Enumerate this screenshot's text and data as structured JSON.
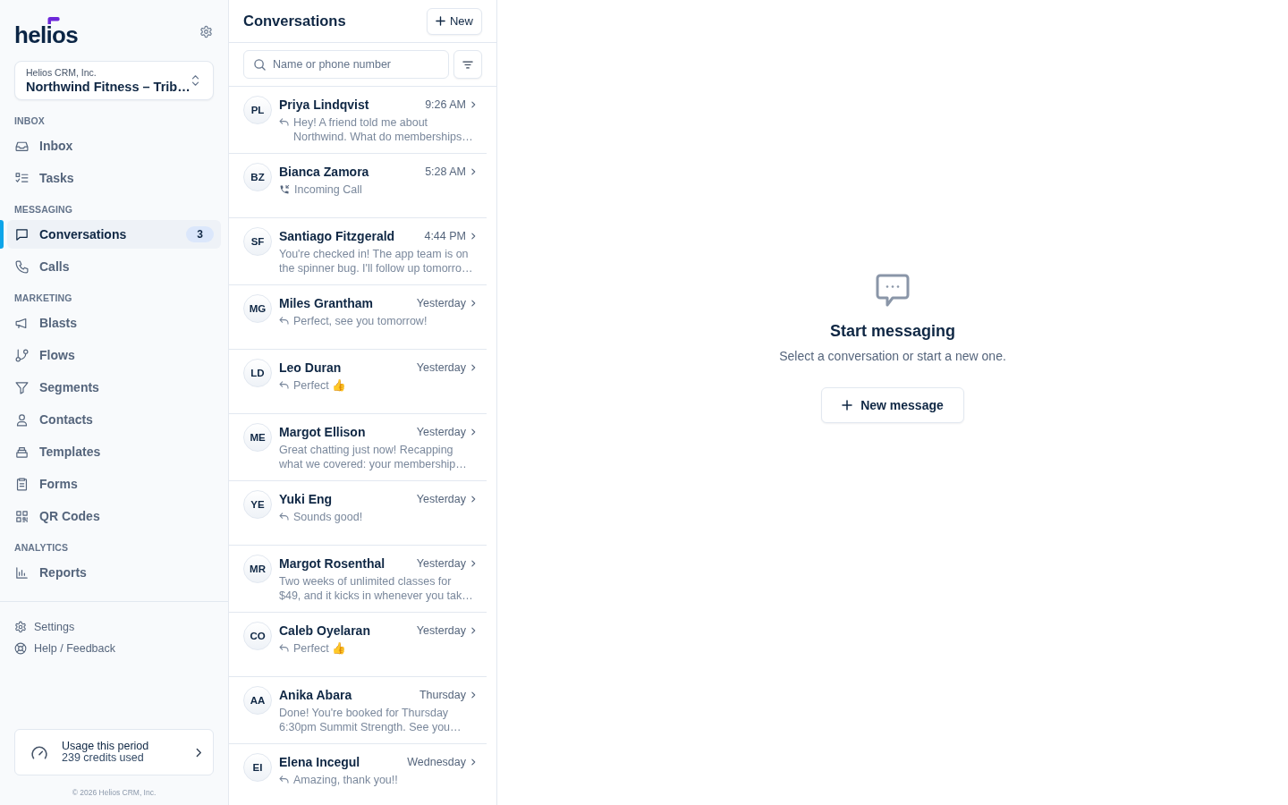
{
  "sidebar": {
    "logo": "helios",
    "workspace": {
      "company": "Helios CRM, Inc.",
      "name": "Northwind Fitness – Trib…"
    },
    "sections": [
      {
        "label": "INBOX",
        "items": [
          {
            "label": "Inbox",
            "selected": false
          },
          {
            "label": "Tasks",
            "selected": false
          }
        ]
      },
      {
        "label": "MESSAGING",
        "items": [
          {
            "label": "Conversations",
            "selected": true,
            "badge": "3"
          },
          {
            "label": "Calls",
            "selected": false
          }
        ]
      },
      {
        "label": "MARKETING",
        "items": [
          {
            "label": "Blasts",
            "selected": false
          },
          {
            "label": "Flows",
            "selected": false
          },
          {
            "label": "Segments",
            "selected": false
          },
          {
            "label": "Contacts",
            "selected": false
          },
          {
            "label": "Templates",
            "selected": false
          },
          {
            "label": "Forms",
            "selected": false
          },
          {
            "label": "QR Codes",
            "selected": false
          }
        ]
      },
      {
        "label": "ANALYTICS",
        "items": [
          {
            "label": "Reports",
            "selected": false
          }
        ]
      }
    ],
    "footer_links": [
      "Settings",
      "Help / Feedback"
    ],
    "usage": {
      "title": "Usage this period",
      "detail": "239 credits used"
    },
    "copyright": "© 2026 Helios CRM, Inc."
  },
  "conversations": {
    "title": "Conversations",
    "new_button": "New",
    "search": {
      "placeholder": "Name or phone number"
    },
    "items": [
      {
        "initials": "PL",
        "name": "Priya Lindqvist",
        "time": "9:26 AM",
        "kind": "reply",
        "preview": "Hey! A friend told me about Northwind. What do memberships…"
      },
      {
        "initials": "BZ",
        "name": "Bianca Zamora",
        "time": "5:28 AM",
        "kind": "call",
        "preview": "Incoming Call"
      },
      {
        "initials": "SF",
        "name": "Santiago Fitzgerald",
        "time": "4:44 PM",
        "kind": "message",
        "preview": "You're checked in! The app team is on the spinner bug. I'll follow up tomorro…"
      },
      {
        "initials": "MG",
        "name": "Miles Grantham",
        "time": "Yesterday",
        "kind": "reply",
        "preview": "Perfect, see you tomorrow!"
      },
      {
        "initials": "LD",
        "name": "Leo Duran",
        "time": "Yesterday",
        "kind": "reply",
        "preview": "Perfect 👍"
      },
      {
        "initials": "ME",
        "name": "Margot Ellison",
        "time": "Yesterday",
        "kind": "message",
        "preview": "Great chatting just now! Recapping what we covered: your membership…"
      },
      {
        "initials": "YE",
        "name": "Yuki Eng",
        "time": "Yesterday",
        "kind": "reply",
        "preview": "Sounds good!"
      },
      {
        "initials": "MR",
        "name": "Margot Rosenthal",
        "time": "Yesterday",
        "kind": "message",
        "preview": "Two weeks of unlimited classes for $49, and it kicks in whenever you tak…"
      },
      {
        "initials": "CO",
        "name": "Caleb Oyelaran",
        "time": "Yesterday",
        "kind": "reply",
        "preview": "Perfect 👍"
      },
      {
        "initials": "AA",
        "name": "Anika Abara",
        "time": "Thursday",
        "kind": "message",
        "preview": "Done! You're booked for Thursday 6:30pm Summit Strength. See you…"
      },
      {
        "initials": "EI",
        "name": "Elena Incegul",
        "time": "Wednesday",
        "kind": "reply",
        "preview": "Amazing, thank you!!"
      }
    ]
  },
  "empty_state": {
    "title": "Start messaging",
    "subtitle": "Select a conversation or start a new one.",
    "button": "New message"
  }
}
